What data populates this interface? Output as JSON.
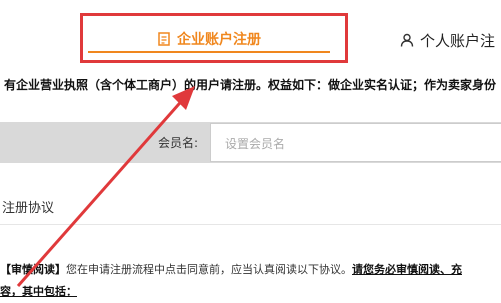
{
  "tabs": {
    "company": {
      "label": "企业账户注册",
      "icon": "document-icon",
      "color": "#f0871e",
      "highlight_color": "#e0393b"
    },
    "personal": {
      "label": "个人账户注",
      "icon": "person-icon"
    }
  },
  "notice": "有企业营业执照（含个体工商户）的用户请注册。权益如下：做企业实名认证；作为卖家身份",
  "form": {
    "member_label": "会员名:",
    "member_placeholder": "设置会员名"
  },
  "agreement": {
    "section_title": "注册协议",
    "prefix": "【审慎阅读】",
    "body": "您在申请注册流程中点击同意前，应当认真阅读以下协议。",
    "emphasis": "请您务必审慎阅读、充",
    "line2": "容，其中包括："
  },
  "annotation": {
    "arrow_color": "#e0393b"
  }
}
